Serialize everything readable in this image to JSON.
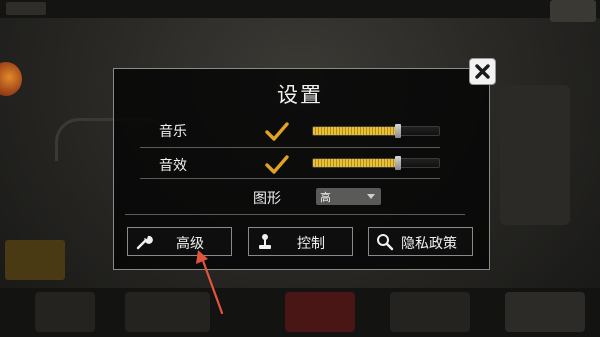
{
  "dialog": {
    "title": "设置",
    "music": {
      "label": "音乐",
      "enabled": true,
      "volume": 0.67
    },
    "sfx": {
      "label": "音效",
      "enabled": true,
      "volume": 0.67
    },
    "graphics": {
      "label": "图形",
      "value": "高"
    },
    "buttons": {
      "advanced": "高级",
      "controls": "控制",
      "privacy": "隐私政策"
    }
  },
  "icons": {
    "close": "close-icon",
    "check": "checkmark-icon",
    "advanced": "wrench-icon",
    "controls": "joystick-icon",
    "privacy": "magnifier-icon",
    "dropdown": "chevron-down-icon"
  },
  "colors": {
    "accent_gold": "#e9c23a",
    "annotation_arrow": "#e0553c"
  }
}
